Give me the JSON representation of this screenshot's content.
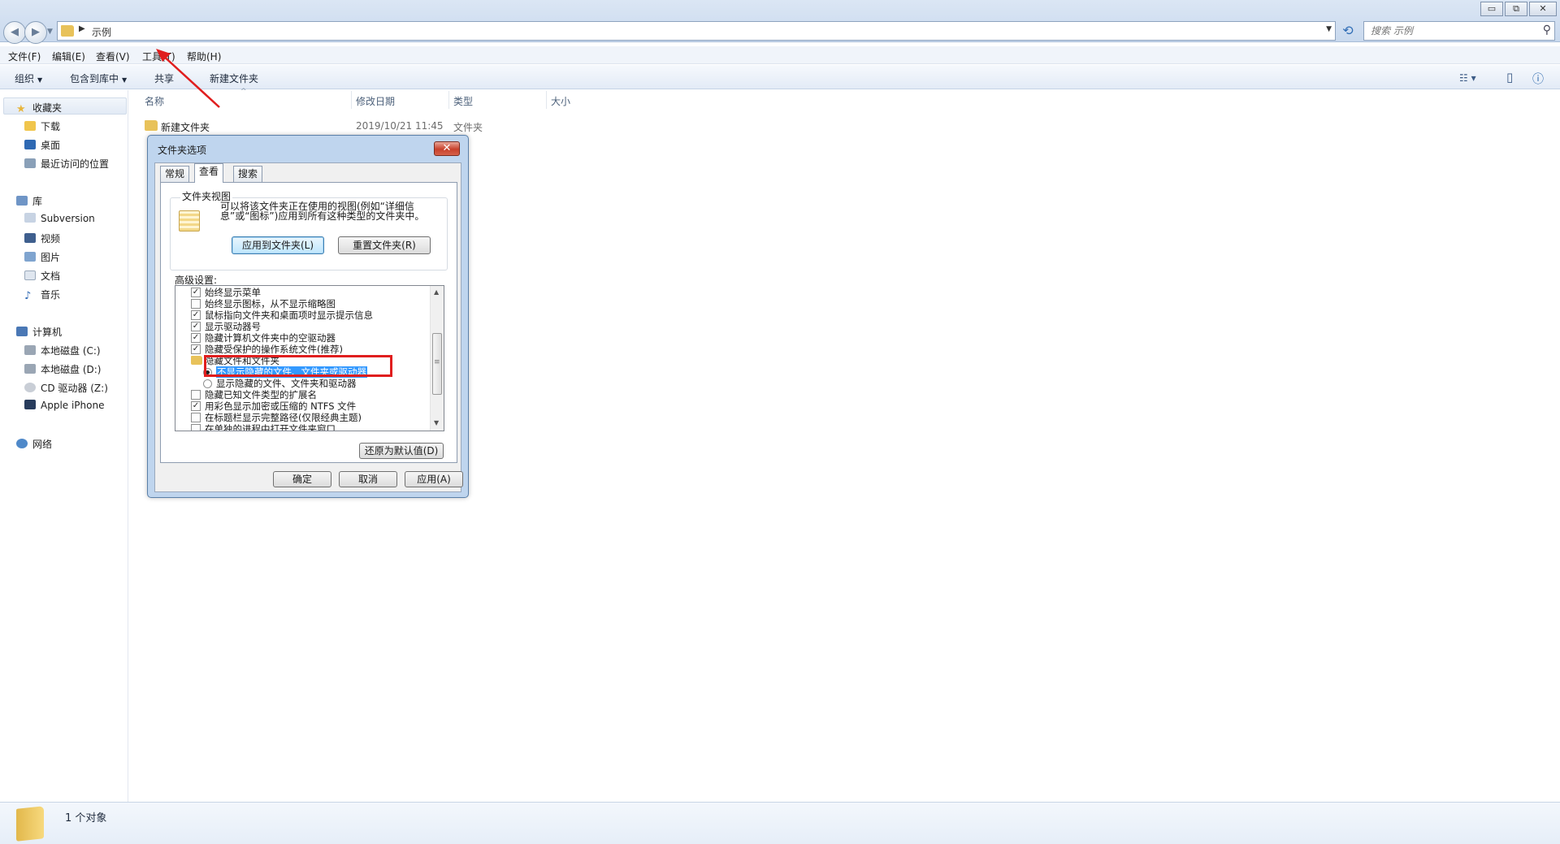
{
  "address": {
    "crumb": "示例",
    "search_placeholder": "搜索 示例"
  },
  "window_controls": {
    "minimize": "▭",
    "maximize": "⧉",
    "close": "✕"
  },
  "menu": [
    "文件(F)",
    "编辑(E)",
    "查看(V)",
    "工具(T)",
    "帮助(H)"
  ],
  "commands": {
    "organize": "组织",
    "include_library": "包含到库中",
    "share": "共享",
    "new_folder": "新建文件夹"
  },
  "nav": {
    "favorites": {
      "label": "收藏夹",
      "items": [
        "下载",
        "桌面",
        "最近访问的位置"
      ]
    },
    "libraries": {
      "label": "库",
      "items": [
        "Subversion",
        "视频",
        "图片",
        "文档",
        "音乐"
      ]
    },
    "computer": {
      "label": "计算机",
      "items": [
        "本地磁盘 (C:)",
        "本地磁盘 (D:)",
        "CD 驱动器 (Z:)",
        "Apple iPhone"
      ]
    },
    "network": {
      "label": "网络"
    }
  },
  "columns": [
    "名称",
    "修改日期",
    "类型",
    "大小"
  ],
  "files": [
    {
      "name": "新建文件夹",
      "date": "2019/10/21 11:45",
      "type": "文件夹"
    }
  ],
  "status": {
    "count": "1 个对象"
  },
  "dialog": {
    "title": "文件夹选项",
    "close": "✕",
    "tabs": [
      "常规",
      "查看",
      "搜索"
    ],
    "active_tab": "查看",
    "folder_view": {
      "label": "文件夹视图",
      "description": "可以将该文件夹正在使用的视图(例如“详细信息”或“图标”)应用到所有这种类型的文件夹中。",
      "apply_button": "应用到文件夹(L)",
      "reset_button": "重置文件夹(R)"
    },
    "advanced_label": "高级设置:",
    "options": [
      {
        "kind": "check",
        "checked": true,
        "label": "始终显示菜单"
      },
      {
        "kind": "check",
        "checked": false,
        "label": "始终显示图标，从不显示缩略图"
      },
      {
        "kind": "check",
        "checked": true,
        "label": "鼠标指向文件夹和桌面项时显示提示信息"
      },
      {
        "kind": "check",
        "checked": true,
        "label": "显示驱动器号"
      },
      {
        "kind": "check",
        "checked": true,
        "label": "隐藏计算机文件夹中的空驱动器"
      },
      {
        "kind": "check",
        "checked": true,
        "label": "隐藏受保护的操作系统文件(推荐)"
      },
      {
        "kind": "folder",
        "label": "隐藏文件和文件夹"
      },
      {
        "kind": "radio",
        "checked": true,
        "selected": true,
        "label": "不显示隐藏的文件、文件夹或驱动器"
      },
      {
        "kind": "radio",
        "checked": false,
        "label": "显示隐藏的文件、文件夹和驱动器"
      },
      {
        "kind": "check",
        "checked": false,
        "label": "隐藏已知文件类型的扩展名"
      },
      {
        "kind": "check",
        "checked": true,
        "label": "用彩色显示加密或压缩的 NTFS 文件"
      },
      {
        "kind": "check",
        "checked": false,
        "label": "在标题栏显示完整路径(仅限经典主题)"
      },
      {
        "kind": "check",
        "checked": false,
        "label": "在单独的进程中打开文件夹窗口"
      }
    ],
    "restore_button": "还原为默认值(D)",
    "ok_button": "确定",
    "cancel_button": "取消",
    "apply_button": "应用(A)"
  },
  "colors": {
    "annotation_red": "#e01e1e",
    "selection_blue": "#3399ff"
  }
}
